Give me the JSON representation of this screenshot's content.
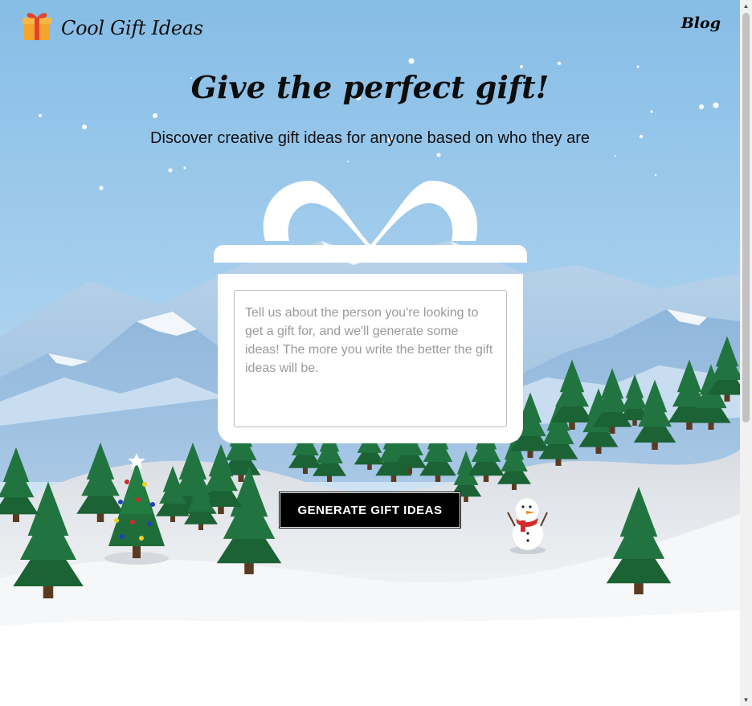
{
  "header": {
    "logo_title": "Cool Gift Ideas",
    "nav": {
      "blog_label": "Blog"
    }
  },
  "hero": {
    "title": "Give the perfect gift!",
    "subtitle": "Discover creative gift ideas for anyone based on who they are"
  },
  "gift_form": {
    "textarea_placeholder": "Tell us about the person you're looking to get a gift for, and we'll generate some ideas! The more you write the better the gift ideas will be.",
    "textarea_value": "",
    "submit_label": "GENERATE GIFT IDEAS"
  },
  "colors": {
    "sky_top": "#86bde6",
    "snow": "#f5f7fb",
    "tree": "#1e6b3a",
    "button_bg": "#000000",
    "ribbon": "#ffffff"
  },
  "icons": [
    "gift-icon",
    "bow-icon",
    "snowman-icon",
    "christmas-tree-icon",
    "snowflake-icon"
  ]
}
